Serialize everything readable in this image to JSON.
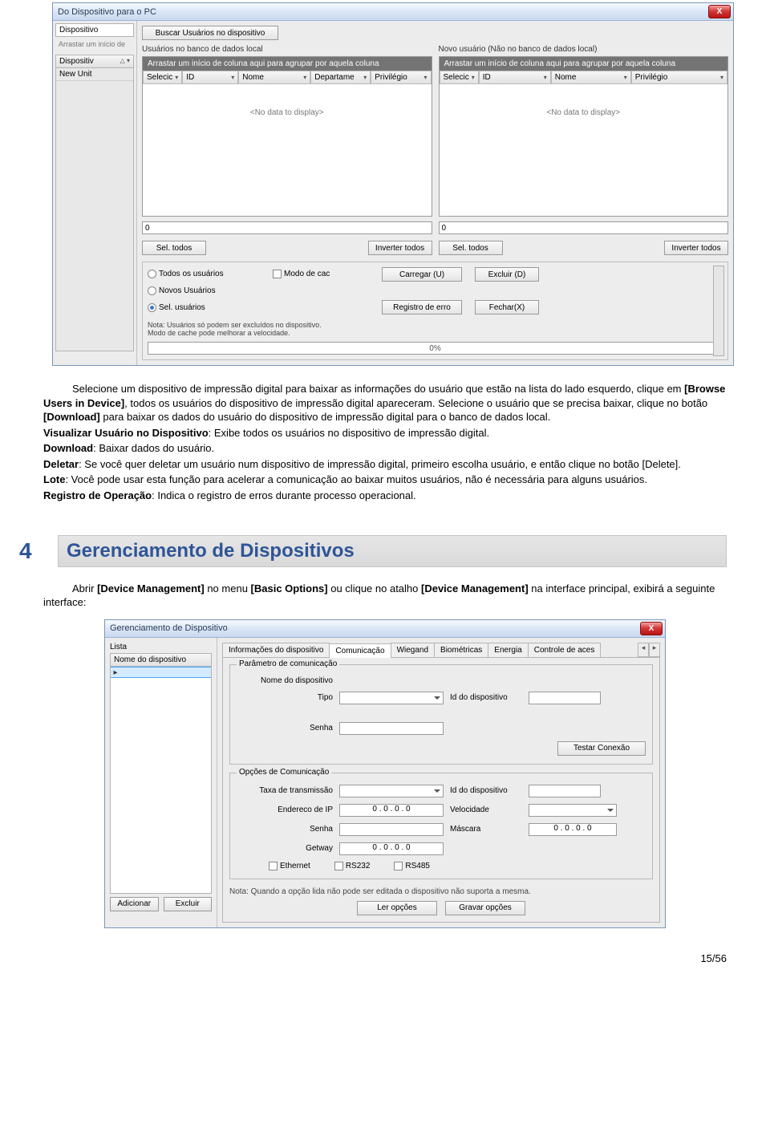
{
  "win1": {
    "title": "Do Dispositivo para o PC",
    "left_tab": "Dispositivo",
    "side_header": "Dispositiv",
    "side_items": [
      "New Unit"
    ],
    "browse_btn": "Buscar Usuários no dispositivo",
    "left_pane_label": "Usuários no banco de dados local",
    "right_pane_label": "Novo usuário (Não no banco de dados local)",
    "grouping_hint": "Arrastar um início de coluna aqui para agrupar por aquela coluna",
    "cols_left": [
      "Selecic",
      "ID",
      "Nome",
      "Departame",
      "Privilégio"
    ],
    "cols_right": [
      "Selecic",
      "ID",
      "Nome",
      "Privilégio"
    ],
    "no_data": "<No data to display>",
    "count_left": "0",
    "count_right": "0",
    "sel_all": "Sel. todos",
    "invert": "Inverter todos",
    "opt_all_users": "Todos os usuários",
    "opt_new_users": "Novos Usuários",
    "opt_sel_users": "Sel. usuários",
    "cache_mode": "Modo de cac",
    "download_btn": "Carregar (U)",
    "delete_btn": "Excluir (D)",
    "errorlog_btn": "Registro de erro",
    "close_btn": "Fechar(X)",
    "note1": "Nota: Usuários só podem ser excluídos no dispositivo.",
    "note2": "Modo de cache pode melhorar a velocidade.",
    "progress": "0%"
  },
  "doc": {
    "p1a": "Selecione um dispositivo de impressão digital para baixar as informações do usuário que estão na lista do lado esquerdo, clique em ",
    "p1b": "[Browse Users in Device]",
    "p1c": ", todos os usuários do dispositivo de impressão digital apareceram. Selecione o usuário que se precisa baixar, clique no botão ",
    "p1d": "[Download]",
    "p1e": " para baixar os dados do usuário do dispositivo de impressão digital para o banco de dados local.",
    "p2a": "Visualizar Usuário no Dispositivo",
    "p2b": ": Exibe todos os usuários no dispositivo de impressão digital.",
    "p3a": "Download",
    "p3b": ": Baixar dados do usuário.",
    "p4a": "Deletar",
    "p4b": ": Se você quer deletar um usuário num dispositivo de impressão digital, primeiro escolha usuário, e então clique no botão [Delete].",
    "p5a": "Lote",
    "p5b": ": Você pode usar esta função para acelerar a comunicação ao baixar muitos usuários, não é necessária para alguns usuários.",
    "p6a": "Registro de Operação",
    "p6b": ": Indica o registro de erros durante processo operacional.",
    "section_num": "4",
    "section_title": "Gerenciamento de Dispositivos",
    "p7a": "Abrir ",
    "p7b": "[Device Management]",
    "p7c": " no menu ",
    "p7d": "[Basic Options]",
    "p7e": " ou clique no atalho ",
    "p7f": "[Device Management]",
    "p7g": " na interface principal, exibirá a seguinte interface:"
  },
  "win2": {
    "title": "Gerenciamento de Dispositivo",
    "lista_label": "Lista",
    "lista_header": "Nome do dispositivo",
    "add_btn": "Adicionar",
    "del_btn": "Excluir",
    "tabs": [
      "Informações do dispositivo",
      "Comunicação",
      "Wiegand",
      "Biométricas",
      "Energia",
      "Controle de aces"
    ],
    "fs1_legend": "Parâmetro de comunicação",
    "lbl_device_name": "Nome do dispositivo",
    "lbl_type": "Tipo",
    "lbl_device_id": "Id do dispositivo",
    "lbl_pwd": "Senha",
    "test_btn": "Testar Conexão",
    "fs2_legend": "Opções de Comunicação",
    "lbl_baud": "Taxa de transmissão",
    "lbl_ip": "Endereco de IP",
    "lbl_speed": "Velocidade",
    "lbl_mask": "Máscara",
    "lbl_gateway": "Getway",
    "chk_eth": "Ethernet",
    "chk_232": "RS232",
    "chk_485": "RS485",
    "ip_default": "0 . 0 . 0 . 0",
    "footer_note": "Nota: Quando a opção lida não pode ser editada o dispositivo não suporta a mesma.",
    "read_btn": "Ler opções",
    "write_btn": "Gravar opções"
  },
  "page_num": "15/56"
}
